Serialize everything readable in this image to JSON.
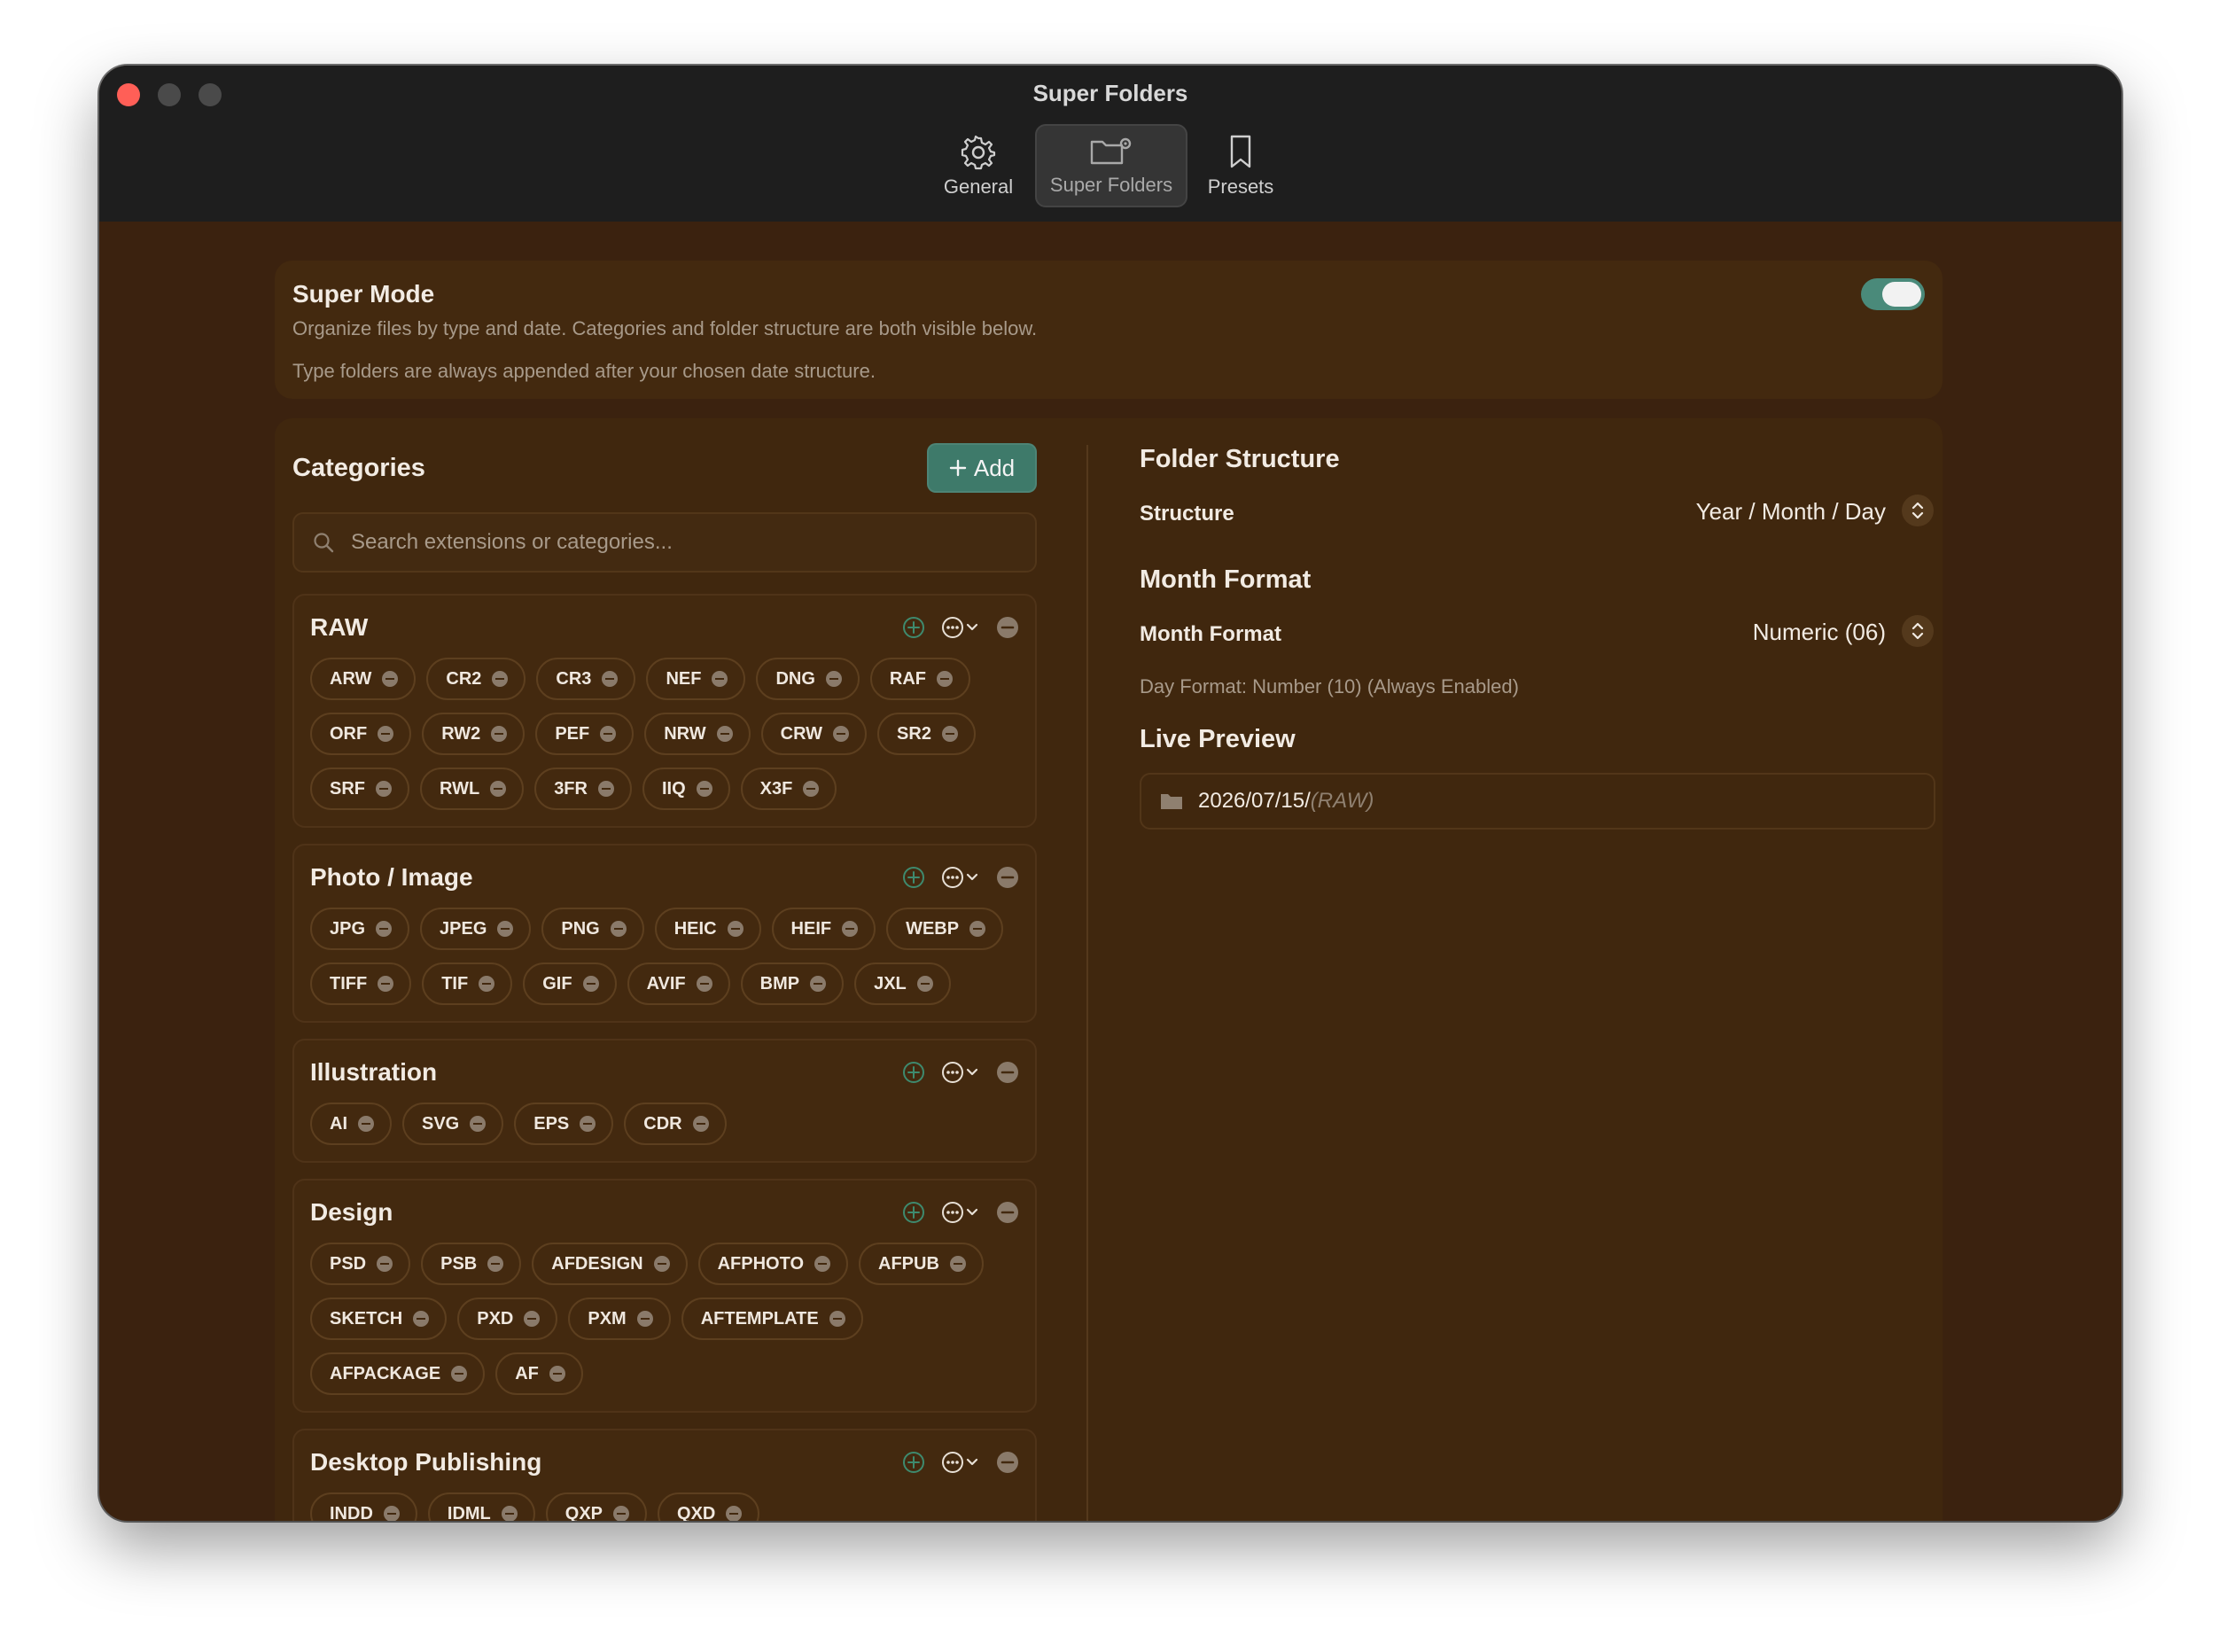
{
  "window": {
    "title": "Super Folders"
  },
  "tabs": [
    {
      "label": "General",
      "icon": "gear-icon"
    },
    {
      "label": "Super Folders",
      "icon": "folder-gear-icon",
      "active": true
    },
    {
      "label": "Presets",
      "icon": "bookmark-icon"
    }
  ],
  "super_mode": {
    "title": "Super Mode",
    "description": "Organize files by type and date. Categories and folder structure are both visible below.",
    "note": "Type folders are always appended after your chosen date structure.",
    "enabled": true
  },
  "categories": {
    "title": "Categories",
    "add_label": "Add",
    "search_placeholder": "Search extensions or categories...",
    "groups": [
      {
        "name": "RAW",
        "extensions": [
          "ARW",
          "CR2",
          "CR3",
          "NEF",
          "DNG",
          "RAF",
          "ORF",
          "RW2",
          "PEF",
          "NRW",
          "CRW",
          "SR2",
          "SRF",
          "RWL",
          "3FR",
          "IIQ",
          "X3F"
        ]
      },
      {
        "name": "Photo / Image",
        "extensions": [
          "JPG",
          "JPEG",
          "PNG",
          "HEIC",
          "HEIF",
          "WEBP",
          "TIFF",
          "TIF",
          "GIF",
          "AVIF",
          "BMP",
          "JXL"
        ]
      },
      {
        "name": "Illustration",
        "extensions": [
          "AI",
          "SVG",
          "EPS",
          "CDR"
        ]
      },
      {
        "name": "Design",
        "extensions": [
          "PSD",
          "PSB",
          "AFDESIGN",
          "AFPHOTO",
          "AFPUB",
          "SKETCH",
          "PXD",
          "PXM",
          "AFTEMPLATE",
          "AFPACKAGE",
          "AF"
        ]
      },
      {
        "name": "Desktop Publishing",
        "extensions": [
          "INDD",
          "IDML",
          "QXP",
          "QXD"
        ]
      }
    ]
  },
  "folder_structure": {
    "title": "Folder Structure",
    "structure_label": "Structure",
    "structure_value": "Year / Month / Day",
    "month_format_title": "Month Format",
    "month_format_label": "Month Format",
    "month_format_value": "Numeric (06)",
    "day_format_note": "Day Format: Number (10) (Always Enabled)",
    "live_preview_title": "Live Preview",
    "preview_path": "2026/07/15/",
    "preview_type": "(RAW)"
  },
  "colors": {
    "accent": "#3e7a6a",
    "toggle_on": "#4a8a7a",
    "background": "#3b220f",
    "close_button": "#ff5f57"
  }
}
